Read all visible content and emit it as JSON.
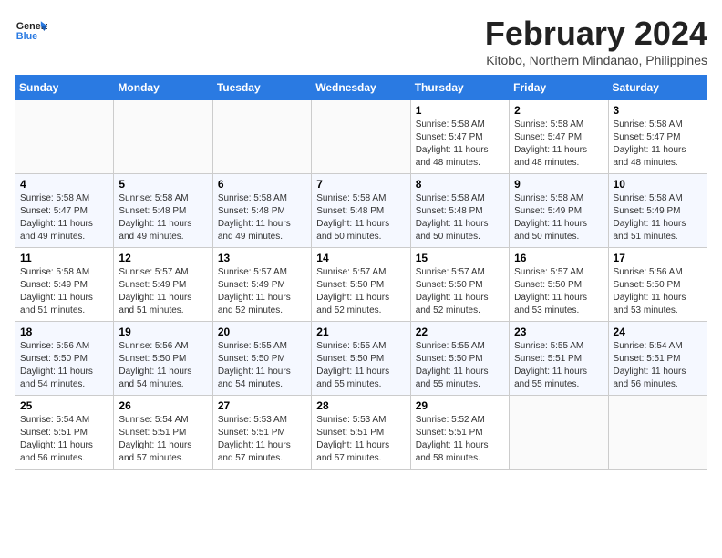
{
  "header": {
    "logo_line1": "General",
    "logo_line2": "Blue",
    "month_title": "February 2024",
    "location": "Kitobo, Northern Mindanao, Philippines"
  },
  "days_of_week": [
    "Sunday",
    "Monday",
    "Tuesday",
    "Wednesday",
    "Thursday",
    "Friday",
    "Saturday"
  ],
  "weeks": [
    [
      {
        "day": "",
        "info": ""
      },
      {
        "day": "",
        "info": ""
      },
      {
        "day": "",
        "info": ""
      },
      {
        "day": "",
        "info": ""
      },
      {
        "day": "1",
        "info": "Sunrise: 5:58 AM\nSunset: 5:47 PM\nDaylight: 11 hours\nand 48 minutes."
      },
      {
        "day": "2",
        "info": "Sunrise: 5:58 AM\nSunset: 5:47 PM\nDaylight: 11 hours\nand 48 minutes."
      },
      {
        "day": "3",
        "info": "Sunrise: 5:58 AM\nSunset: 5:47 PM\nDaylight: 11 hours\nand 48 minutes."
      }
    ],
    [
      {
        "day": "4",
        "info": "Sunrise: 5:58 AM\nSunset: 5:47 PM\nDaylight: 11 hours\nand 49 minutes."
      },
      {
        "day": "5",
        "info": "Sunrise: 5:58 AM\nSunset: 5:48 PM\nDaylight: 11 hours\nand 49 minutes."
      },
      {
        "day": "6",
        "info": "Sunrise: 5:58 AM\nSunset: 5:48 PM\nDaylight: 11 hours\nand 49 minutes."
      },
      {
        "day": "7",
        "info": "Sunrise: 5:58 AM\nSunset: 5:48 PM\nDaylight: 11 hours\nand 50 minutes."
      },
      {
        "day": "8",
        "info": "Sunrise: 5:58 AM\nSunset: 5:48 PM\nDaylight: 11 hours\nand 50 minutes."
      },
      {
        "day": "9",
        "info": "Sunrise: 5:58 AM\nSunset: 5:49 PM\nDaylight: 11 hours\nand 50 minutes."
      },
      {
        "day": "10",
        "info": "Sunrise: 5:58 AM\nSunset: 5:49 PM\nDaylight: 11 hours\nand 51 minutes."
      }
    ],
    [
      {
        "day": "11",
        "info": "Sunrise: 5:58 AM\nSunset: 5:49 PM\nDaylight: 11 hours\nand 51 minutes."
      },
      {
        "day": "12",
        "info": "Sunrise: 5:57 AM\nSunset: 5:49 PM\nDaylight: 11 hours\nand 51 minutes."
      },
      {
        "day": "13",
        "info": "Sunrise: 5:57 AM\nSunset: 5:49 PM\nDaylight: 11 hours\nand 52 minutes."
      },
      {
        "day": "14",
        "info": "Sunrise: 5:57 AM\nSunset: 5:50 PM\nDaylight: 11 hours\nand 52 minutes."
      },
      {
        "day": "15",
        "info": "Sunrise: 5:57 AM\nSunset: 5:50 PM\nDaylight: 11 hours\nand 52 minutes."
      },
      {
        "day": "16",
        "info": "Sunrise: 5:57 AM\nSunset: 5:50 PM\nDaylight: 11 hours\nand 53 minutes."
      },
      {
        "day": "17",
        "info": "Sunrise: 5:56 AM\nSunset: 5:50 PM\nDaylight: 11 hours\nand 53 minutes."
      }
    ],
    [
      {
        "day": "18",
        "info": "Sunrise: 5:56 AM\nSunset: 5:50 PM\nDaylight: 11 hours\nand 54 minutes."
      },
      {
        "day": "19",
        "info": "Sunrise: 5:56 AM\nSunset: 5:50 PM\nDaylight: 11 hours\nand 54 minutes."
      },
      {
        "day": "20",
        "info": "Sunrise: 5:55 AM\nSunset: 5:50 PM\nDaylight: 11 hours\nand 54 minutes."
      },
      {
        "day": "21",
        "info": "Sunrise: 5:55 AM\nSunset: 5:50 PM\nDaylight: 11 hours\nand 55 minutes."
      },
      {
        "day": "22",
        "info": "Sunrise: 5:55 AM\nSunset: 5:50 PM\nDaylight: 11 hours\nand 55 minutes."
      },
      {
        "day": "23",
        "info": "Sunrise: 5:55 AM\nSunset: 5:51 PM\nDaylight: 11 hours\nand 55 minutes."
      },
      {
        "day": "24",
        "info": "Sunrise: 5:54 AM\nSunset: 5:51 PM\nDaylight: 11 hours\nand 56 minutes."
      }
    ],
    [
      {
        "day": "25",
        "info": "Sunrise: 5:54 AM\nSunset: 5:51 PM\nDaylight: 11 hours\nand 56 minutes."
      },
      {
        "day": "26",
        "info": "Sunrise: 5:54 AM\nSunset: 5:51 PM\nDaylight: 11 hours\nand 57 minutes."
      },
      {
        "day": "27",
        "info": "Sunrise: 5:53 AM\nSunset: 5:51 PM\nDaylight: 11 hours\nand 57 minutes."
      },
      {
        "day": "28",
        "info": "Sunrise: 5:53 AM\nSunset: 5:51 PM\nDaylight: 11 hours\nand 57 minutes."
      },
      {
        "day": "29",
        "info": "Sunrise: 5:52 AM\nSunset: 5:51 PM\nDaylight: 11 hours\nand 58 minutes."
      },
      {
        "day": "",
        "info": ""
      },
      {
        "day": "",
        "info": ""
      }
    ]
  ]
}
